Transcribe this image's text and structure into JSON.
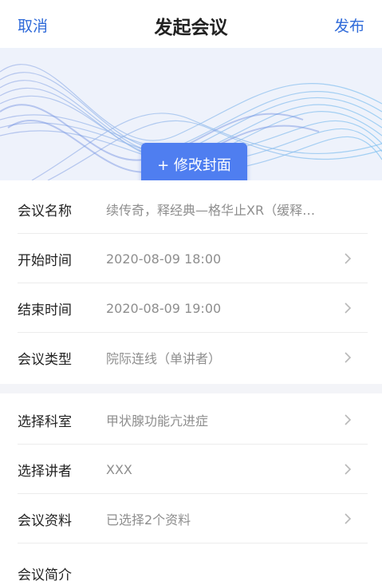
{
  "nav": {
    "cancel_label": "取消",
    "title": "发起会议",
    "publish_label": "发布"
  },
  "cover": {
    "button_label": "+ 修改封面"
  },
  "section1": [
    {
      "label": "会议名称",
      "value": "续传奇，释经典—格华止XR（缓释…"
    },
    {
      "label": "开始时间",
      "value": "2020-08-09 18:00"
    },
    {
      "label": "结束时间",
      "value": "2020-08-09 19:00"
    },
    {
      "label": "会议类型",
      "value": "院际连线（单讲者）"
    }
  ],
  "section2": [
    {
      "label": "选择科室",
      "value": "甲状腺功能亢进症"
    },
    {
      "label": "选择讲者",
      "value": "XXX"
    },
    {
      "label": "会议资料",
      "value": "已选择2个资料"
    }
  ],
  "intro": {
    "label": "会议简介"
  },
  "colors": {
    "accent": "#2f6ad9",
    "button": "#4f7ef0"
  },
  "icons": {
    "row_chevron": "chevron-right-icon"
  }
}
